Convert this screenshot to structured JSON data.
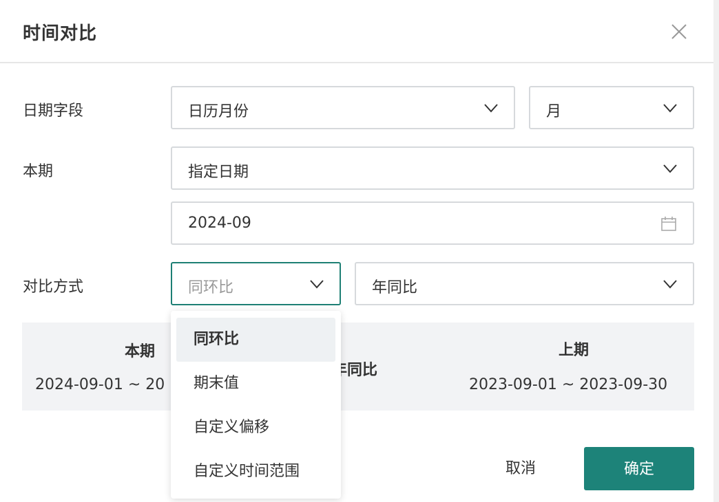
{
  "dialog": {
    "title": "时间对比"
  },
  "form": {
    "date_field": {
      "label": "日期字段",
      "field_value": "日历月份",
      "granularity_value": "月"
    },
    "current_period": {
      "label": "本期",
      "mode_value": "指定日期",
      "date_value": "2024-09"
    },
    "compare_method": {
      "label": "对比方式",
      "type_value": "同环比",
      "sub_value": "年同比"
    }
  },
  "summary": {
    "current_label": "本期",
    "current_range": "2024-09-01 ~ 20",
    "mid_label": "年同比",
    "previous_label": "上期",
    "previous_range": "2023-09-01 ~ 2023-09-30"
  },
  "dropdown": {
    "options": [
      {
        "label": "同环比",
        "selected": true
      },
      {
        "label": "期末值",
        "selected": false
      },
      {
        "label": "自定义偏移",
        "selected": false
      },
      {
        "label": "自定义时间范围",
        "selected": false
      }
    ]
  },
  "footer": {
    "cancel_label": "取消",
    "ok_label": "确定"
  },
  "icons": {
    "close": "close-icon",
    "chevron": "chevron-down-icon",
    "calendar": "calendar-icon"
  },
  "colors": {
    "accent": "#1d8379",
    "focus_border": "#1d7f74",
    "summary_bg": "#f2f3f5",
    "option_hover_bg": "#eef1f3"
  }
}
